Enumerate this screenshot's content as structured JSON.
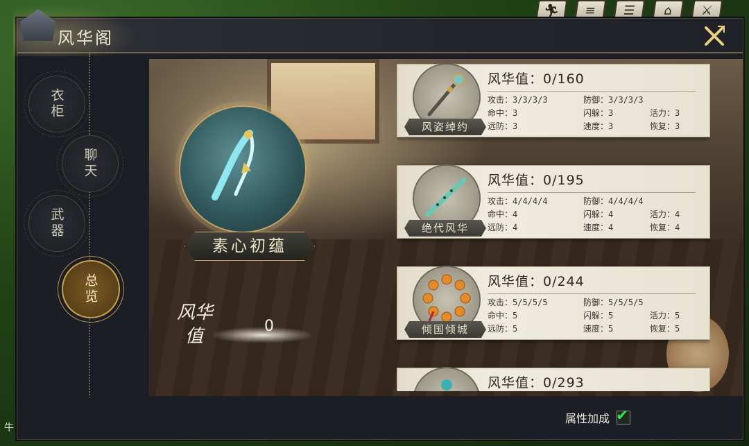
{
  "window": {
    "title": "风华阁"
  },
  "top_icons": [
    "figure-icon",
    "book-icon",
    "scroll-icon",
    "pavilion-icon",
    "crossed-swords-icon"
  ],
  "nav": {
    "items": [
      {
        "label": "衣柜",
        "active": false
      },
      {
        "label": "聊天",
        "active": false
      },
      {
        "label": "武器",
        "active": false
      },
      {
        "label": "总览",
        "active": true
      }
    ]
  },
  "featured": {
    "name": "素心初蕴",
    "score_label_1": "风华",
    "score_label_2": "值",
    "score_value": "0"
  },
  "cards": [
    {
      "name": "风姿绰约",
      "fhv": "风华值：0/160",
      "stats": [
        "攻击：3/3/3/3",
        "防御：3/3/3/3",
        "",
        "命中：3",
        "闪躲：3",
        "活力：3",
        "远防：3",
        "速度：3",
        "恢复：3"
      ]
    },
    {
      "name": "绝代风华",
      "fhv": "风华值：0/195",
      "stats": [
        "攻击：4/4/4/4",
        "防御：4/4/4/4",
        "",
        "命中：4",
        "闪躲：4",
        "活力：4",
        "远防：4",
        "速度：4",
        "恢复：4"
      ]
    },
    {
      "name": "倾国倾城",
      "fhv": "风华值：0/244",
      "stats": [
        "攻击：5/5/5/5",
        "防御：5/5/5/5",
        "",
        "命中：5",
        "闪躲：5",
        "活力：5",
        "远防：5",
        "速度：5",
        "恢复：5"
      ]
    },
    {
      "name": "",
      "fhv": "风华值：0/293",
      "stats": []
    }
  ],
  "attr_toggle": {
    "label": "属性加成",
    "checked": true
  },
  "outside_text": "牛",
  "colors": {
    "accent_gold": "#c3a46a",
    "check_green": "#3ddc57",
    "card_bg": "#ece6d8"
  }
}
